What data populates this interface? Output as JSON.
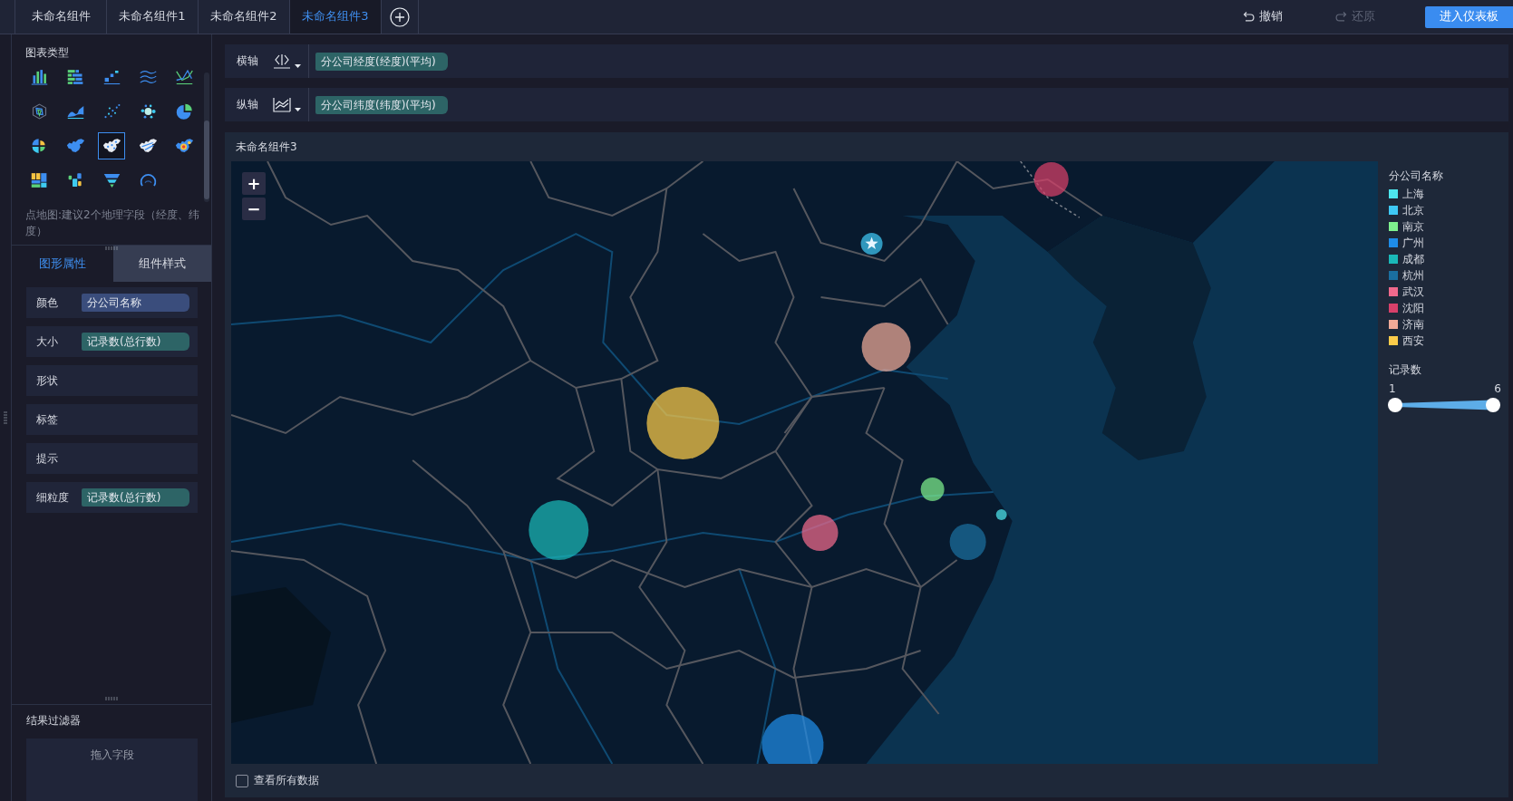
{
  "tabs": [
    {
      "label": "未命名组件",
      "selected": false
    },
    {
      "label": "未命名组件1",
      "selected": false
    },
    {
      "label": "未命名组件2",
      "selected": false
    },
    {
      "label": "未命名组件3",
      "selected": true
    }
  ],
  "toolbar": {
    "undo": {
      "label": "撤销",
      "disabled": false
    },
    "redo": {
      "label": "还原",
      "disabled": true
    },
    "primary_button": "进入仪表板"
  },
  "chart_types": {
    "title": "图表类型",
    "items": [
      {
        "kind": "column",
        "selected": false
      },
      {
        "kind": "bar",
        "selected": false
      },
      {
        "kind": "step",
        "selected": false
      },
      {
        "kind": "multiline",
        "selected": false
      },
      {
        "kind": "combo",
        "selected": false
      },
      {
        "kind": "radar",
        "selected": false
      },
      {
        "kind": "area",
        "selected": false
      },
      {
        "kind": "scatter",
        "selected": false
      },
      {
        "kind": "bubble",
        "selected": false
      },
      {
        "kind": "pie",
        "selected": false
      },
      {
        "kind": "rose",
        "selected": false
      },
      {
        "kind": "map",
        "selected": false
      },
      {
        "kind": "pointmap",
        "selected": true
      },
      {
        "kind": "flowmap",
        "selected": false
      },
      {
        "kind": "heatmap",
        "selected": false
      },
      {
        "kind": "treemap",
        "selected": false
      },
      {
        "kind": "wordcloud",
        "selected": false
      },
      {
        "kind": "funnel",
        "selected": false
      },
      {
        "kind": "gauge",
        "selected": false
      }
    ],
    "hint": "点地图:建议2个地理字段（经度、纬度）"
  },
  "property_tabs": [
    {
      "label": "图形属性",
      "selected": true
    },
    {
      "label": "组件样式",
      "selected": false
    }
  ],
  "properties": [
    {
      "label": "颜色",
      "field": {
        "text": "分公司名称",
        "kind": "dimension"
      }
    },
    {
      "label": "大小",
      "field": {
        "text": "记录数(总行数)",
        "kind": "measure"
      }
    },
    {
      "label": "形状"
    },
    {
      "label": "标签"
    },
    {
      "label": "提示"
    },
    {
      "label": "细粒度",
      "field": {
        "text": "记录数(总行数)",
        "kind": "measure"
      }
    }
  ],
  "filter": {
    "title": "结果过滤器",
    "drop_hint": "拖入字段"
  },
  "axes": [
    {
      "label": "横轴",
      "kind": "horizontal",
      "field": {
        "text": "分公司经度(经度)(平均)",
        "kind": "measure"
      }
    },
    {
      "label": "纵轴",
      "kind": "vertical",
      "field": {
        "text": "分公司纬度(纬度)(平均)",
        "kind": "measure"
      }
    }
  ],
  "chart_card": {
    "title": "未命名组件3",
    "zoom_controls": [
      "+",
      "−"
    ],
    "legend": {
      "title": "分公司名称",
      "items": [
        {
          "label": "上海",
          "color": "#4de6ee"
        },
        {
          "label": "北京",
          "color": "#3ec8f5"
        },
        {
          "label": "南京",
          "color": "#7ef08e"
        },
        {
          "label": "广州",
          "color": "#1e8ce8"
        },
        {
          "label": "成都",
          "color": "#1ab8b8"
        },
        {
          "label": "杭州",
          "color": "#1a6fa0"
        },
        {
          "label": "武汉",
          "color": "#f0698c"
        },
        {
          "label": "沈阳",
          "color": "#d8406a"
        },
        {
          "label": "济南",
          "color": "#f0aa98"
        },
        {
          "label": "西安",
          "color": "#fccc4a"
        }
      ]
    },
    "size_legend": {
      "title": "记录数",
      "min_label": "1",
      "max_label": "6",
      "level": 1
    },
    "show_all": {
      "label": "查看所有数据",
      "checked": false
    }
  }
}
